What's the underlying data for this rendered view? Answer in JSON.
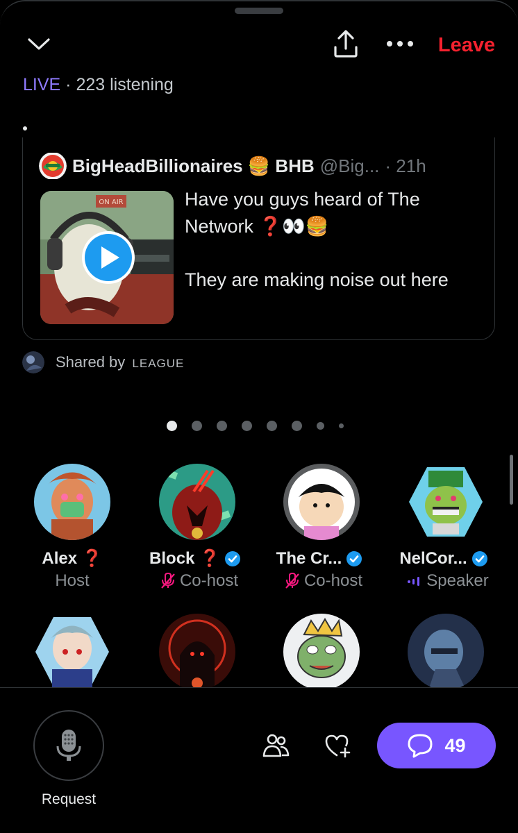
{
  "header": {
    "collapse_icon": "chevron-down-icon",
    "share_icon": "share-upload-icon",
    "more_icon": "more-dots-icon",
    "leave_label": "Leave",
    "leave_color": "#f4212e"
  },
  "status": {
    "live_label": "LIVE",
    "separator": "·",
    "listening_text": "223 listening"
  },
  "pinned_post": {
    "author_name": "BigHeadBillionaires 🍔 BHB",
    "handle": "@Big...",
    "time": "· 21h",
    "text_line1": "Have you guys heard of The Network ❓👀🍔",
    "text_line2": "They are making noise out here",
    "media_icon": "play-icon"
  },
  "shared_by": {
    "prefix": "Shared by",
    "org": "LEAGUE"
  },
  "pager": {
    "pages": 8,
    "active_index": 0
  },
  "speakers": [
    {
      "name": "Alex ❓",
      "role": "Host",
      "verified": false,
      "role_icon": ""
    },
    {
      "name": "Block ❓",
      "role": "Co-host",
      "verified": true,
      "role_icon": "mic-muted-icon"
    },
    {
      "name": "The Cr...",
      "role": "Co-host",
      "verified": true,
      "role_icon": "mic-muted-icon"
    },
    {
      "name": "NelCor...",
      "role": "Speaker",
      "verified": true,
      "role_icon": "audio-level-icon"
    }
  ],
  "bottom": {
    "request_label": "Request",
    "mic_icon": "microphone-icon",
    "people_icon": "people-icon",
    "heart_icon": "heart-plus-icon",
    "comments_icon": "chat-bubble-icon",
    "comments_count": "49"
  },
  "colors": {
    "accent": "#7856ff",
    "live": "#8f7bff",
    "verified": "#1d9bf0",
    "muted_mic": "#f91880"
  }
}
